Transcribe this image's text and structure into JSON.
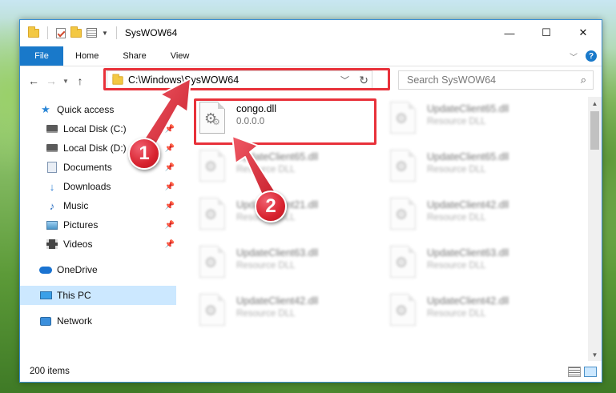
{
  "window": {
    "title": "SysWOW64",
    "controls": {
      "minimize": "—",
      "maximize": "☐",
      "close": "✕"
    }
  },
  "ribbon": {
    "tabs": [
      "File",
      "Home",
      "Share",
      "View"
    ],
    "help": "?"
  },
  "address": {
    "path": "C:\\Windows\\SysWOW64"
  },
  "search": {
    "placeholder": "Search SysWOW64"
  },
  "nav_pane": {
    "quick_access": "Quick access",
    "items": [
      "Local Disk (C:)",
      "Local Disk (D:)",
      "Documents",
      "Downloads",
      "Music",
      "Pictures",
      "Videos"
    ],
    "onedrive": "OneDrive",
    "this_pc": "This PC",
    "network": "Network"
  },
  "files": {
    "highlighted": {
      "name": "congo.dll",
      "type": "0.0.0.0"
    },
    "blurred": [
      {
        "name": "UpdateClient65.dll",
        "type": "Resource DLL"
      },
      {
        "name": "UpdateClient65.dll",
        "type": "Resource DLL"
      },
      {
        "name": "UpdateClient65.dll",
        "type": "Resource DLL"
      },
      {
        "name": "UpdateClient21.dll",
        "type": "Resource DLL"
      },
      {
        "name": "UpdateClient42.dll",
        "type": "Resource DLL"
      },
      {
        "name": "UpdateClient63.dll",
        "type": "Resource DLL"
      },
      {
        "name": "UpdateClient63.dll",
        "type": "Resource DLL"
      },
      {
        "name": "UpdateClient42.dll",
        "type": "Resource DLL"
      },
      {
        "name": "UpdateClient42.dll",
        "type": "Resource DLL"
      }
    ]
  },
  "status": {
    "item_count": "200 items"
  },
  "annotations": {
    "step1": "1",
    "step2": "2",
    "color": "#e8313a"
  }
}
